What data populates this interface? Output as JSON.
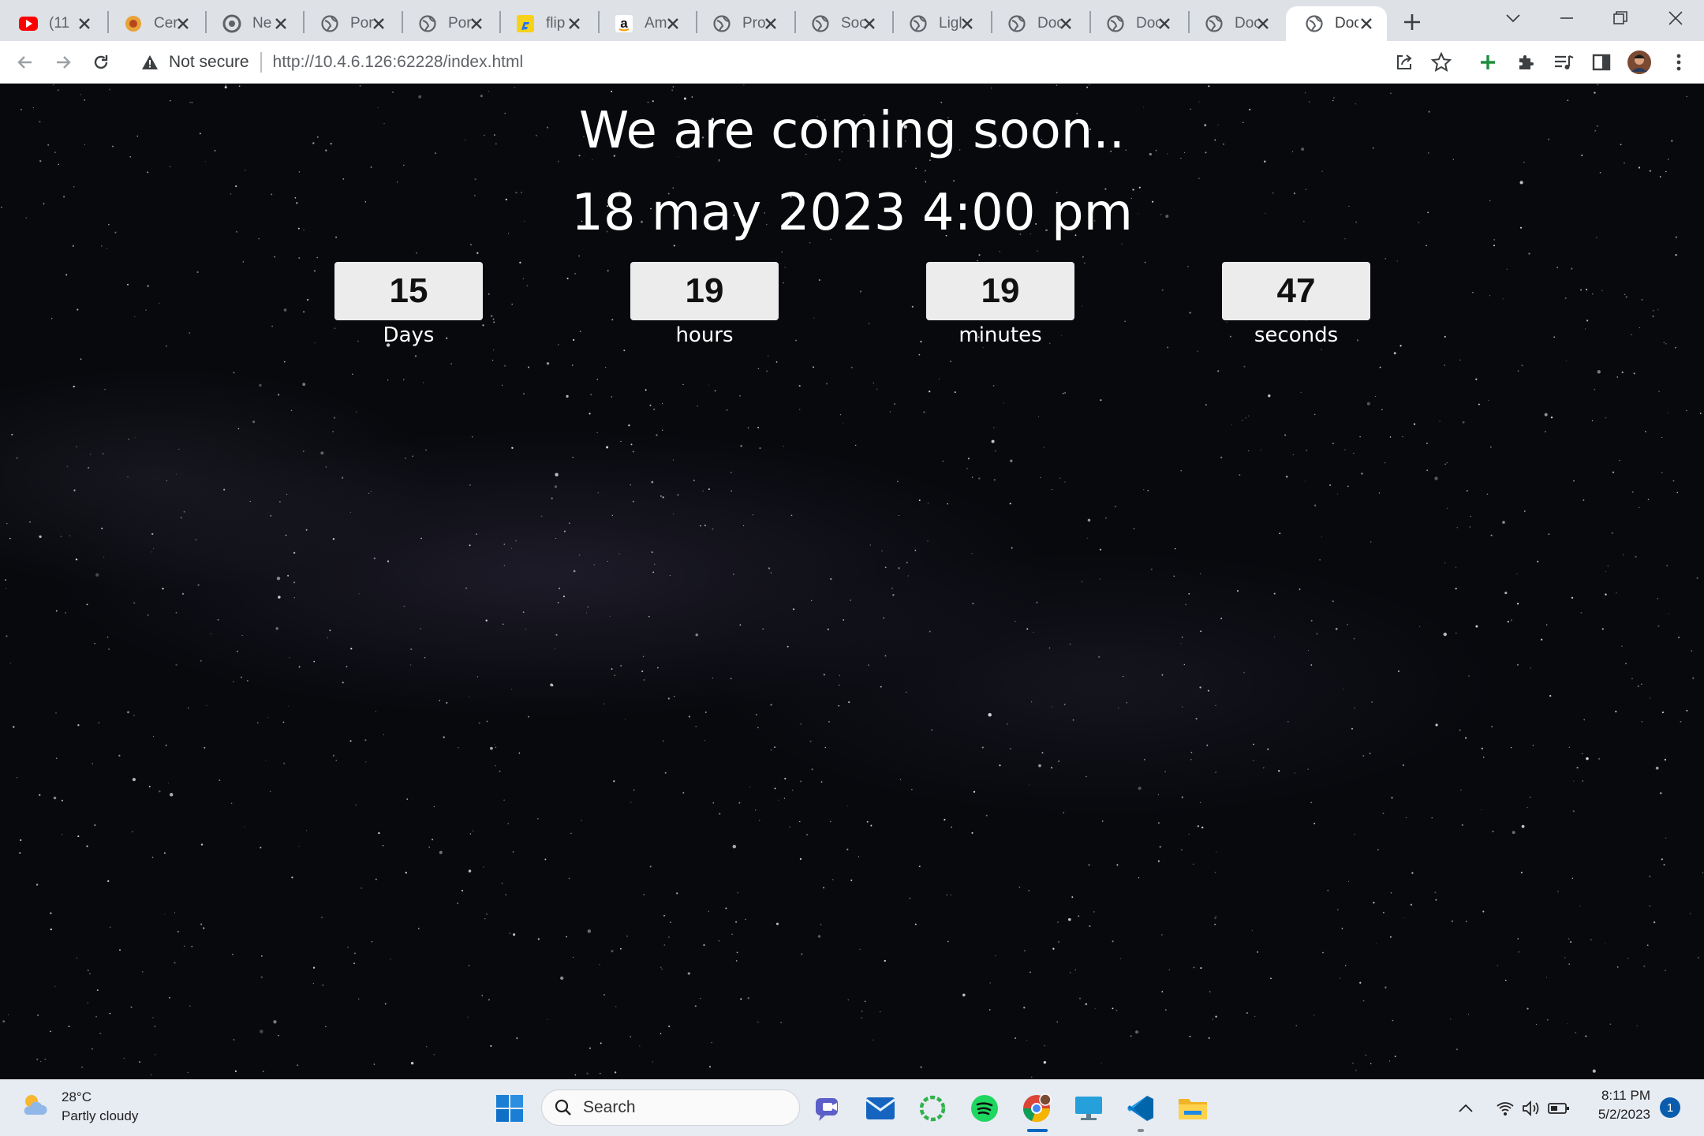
{
  "browser": {
    "tabs": [
      {
        "title": "(11",
        "icon": "youtube-icon"
      },
      {
        "title": "Cer",
        "icon": "cert-icon"
      },
      {
        "title": "Ne",
        "icon": "chrome-icon"
      },
      {
        "title": "Por",
        "icon": "globe-icon"
      },
      {
        "title": "Por",
        "icon": "globe-icon"
      },
      {
        "title": "flip",
        "icon": "flipkart-icon"
      },
      {
        "title": "Am",
        "icon": "amazon-icon"
      },
      {
        "title": "Pro",
        "icon": "globe-icon"
      },
      {
        "title": "Soc",
        "icon": "globe-icon"
      },
      {
        "title": "Ligl",
        "icon": "globe-icon"
      },
      {
        "title": "Doc",
        "icon": "globe-icon"
      },
      {
        "title": "Doc",
        "icon": "globe-icon"
      },
      {
        "title": "Doc",
        "icon": "globe-icon"
      },
      {
        "title": "Doc",
        "icon": "globe-icon",
        "active": true
      }
    ],
    "security_label": "Not secure",
    "url": "http://10.4.6.126:62228/index.html"
  },
  "page": {
    "heading": "We are coming soon..",
    "launch_date": "18 may 2023 4:00 pm",
    "countdown": [
      {
        "value": "15",
        "label": "Days"
      },
      {
        "value": "19",
        "label": "hours"
      },
      {
        "value": "19",
        "label": "minutes"
      },
      {
        "value": "47",
        "label": "seconds"
      }
    ]
  },
  "taskbar": {
    "weather_temp": "28°C",
    "weather_desc": "Partly cloudy",
    "search_placeholder": "Search",
    "time": "8:11 PM",
    "date": "5/2/2023",
    "notifications": "1"
  },
  "colors": {
    "tabstrip": "#dee1e6",
    "page_bg": "#07090d",
    "counter_box": "#ececec",
    "accent": "#0067c0"
  }
}
